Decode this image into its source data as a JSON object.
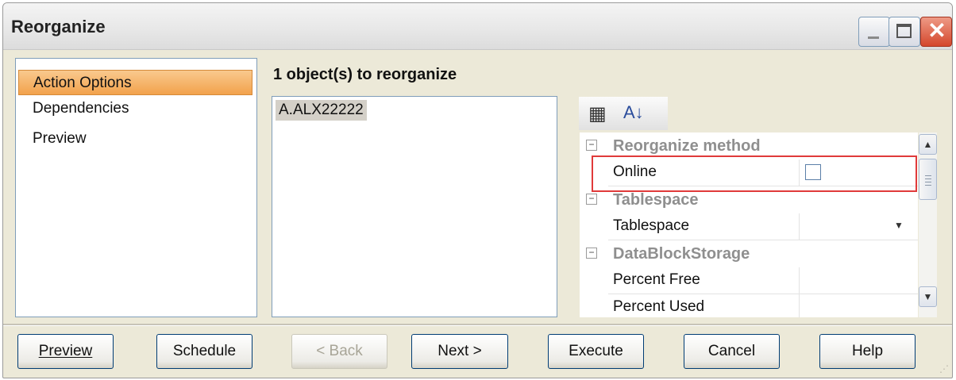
{
  "window": {
    "title": "Reorganize"
  },
  "nav": {
    "items": [
      {
        "label": "Action Options",
        "selected": true
      },
      {
        "label": "Dependencies",
        "selected": false
      },
      {
        "label": "Preview",
        "selected": false
      }
    ]
  },
  "objects": {
    "heading": "1 object(s) to reorganize",
    "items": [
      "A.ALX22222"
    ]
  },
  "property_grid": {
    "toolbar": {
      "categorized_icon": "categorized-icon",
      "alpha_sort_icon": "alpha-sort-icon"
    },
    "categories": [
      {
        "label": "Reorganize method",
        "toggle": "⊟",
        "rows": [
          {
            "name": "Online",
            "type": "checkbox",
            "checked": false
          }
        ]
      },
      {
        "label": "Tablespace",
        "toggle": "⊟",
        "rows": [
          {
            "name": "Tablespace",
            "type": "dropdown",
            "value": ""
          }
        ]
      },
      {
        "label": "DataBlockStorage",
        "toggle": "⊟",
        "rows": [
          {
            "name": "Percent Free",
            "type": "text"
          },
          {
            "name": "Percent Used",
            "type": "text"
          }
        ]
      }
    ]
  },
  "buttons": {
    "preview": "Preview",
    "schedule": "Schedule",
    "back": "< Back",
    "next": "Next >",
    "execute": "Execute",
    "cancel": "Cancel",
    "help": "Help"
  },
  "colors": {
    "selected_nav": "#f2a24c",
    "highlight_border": "#e03a3a"
  }
}
